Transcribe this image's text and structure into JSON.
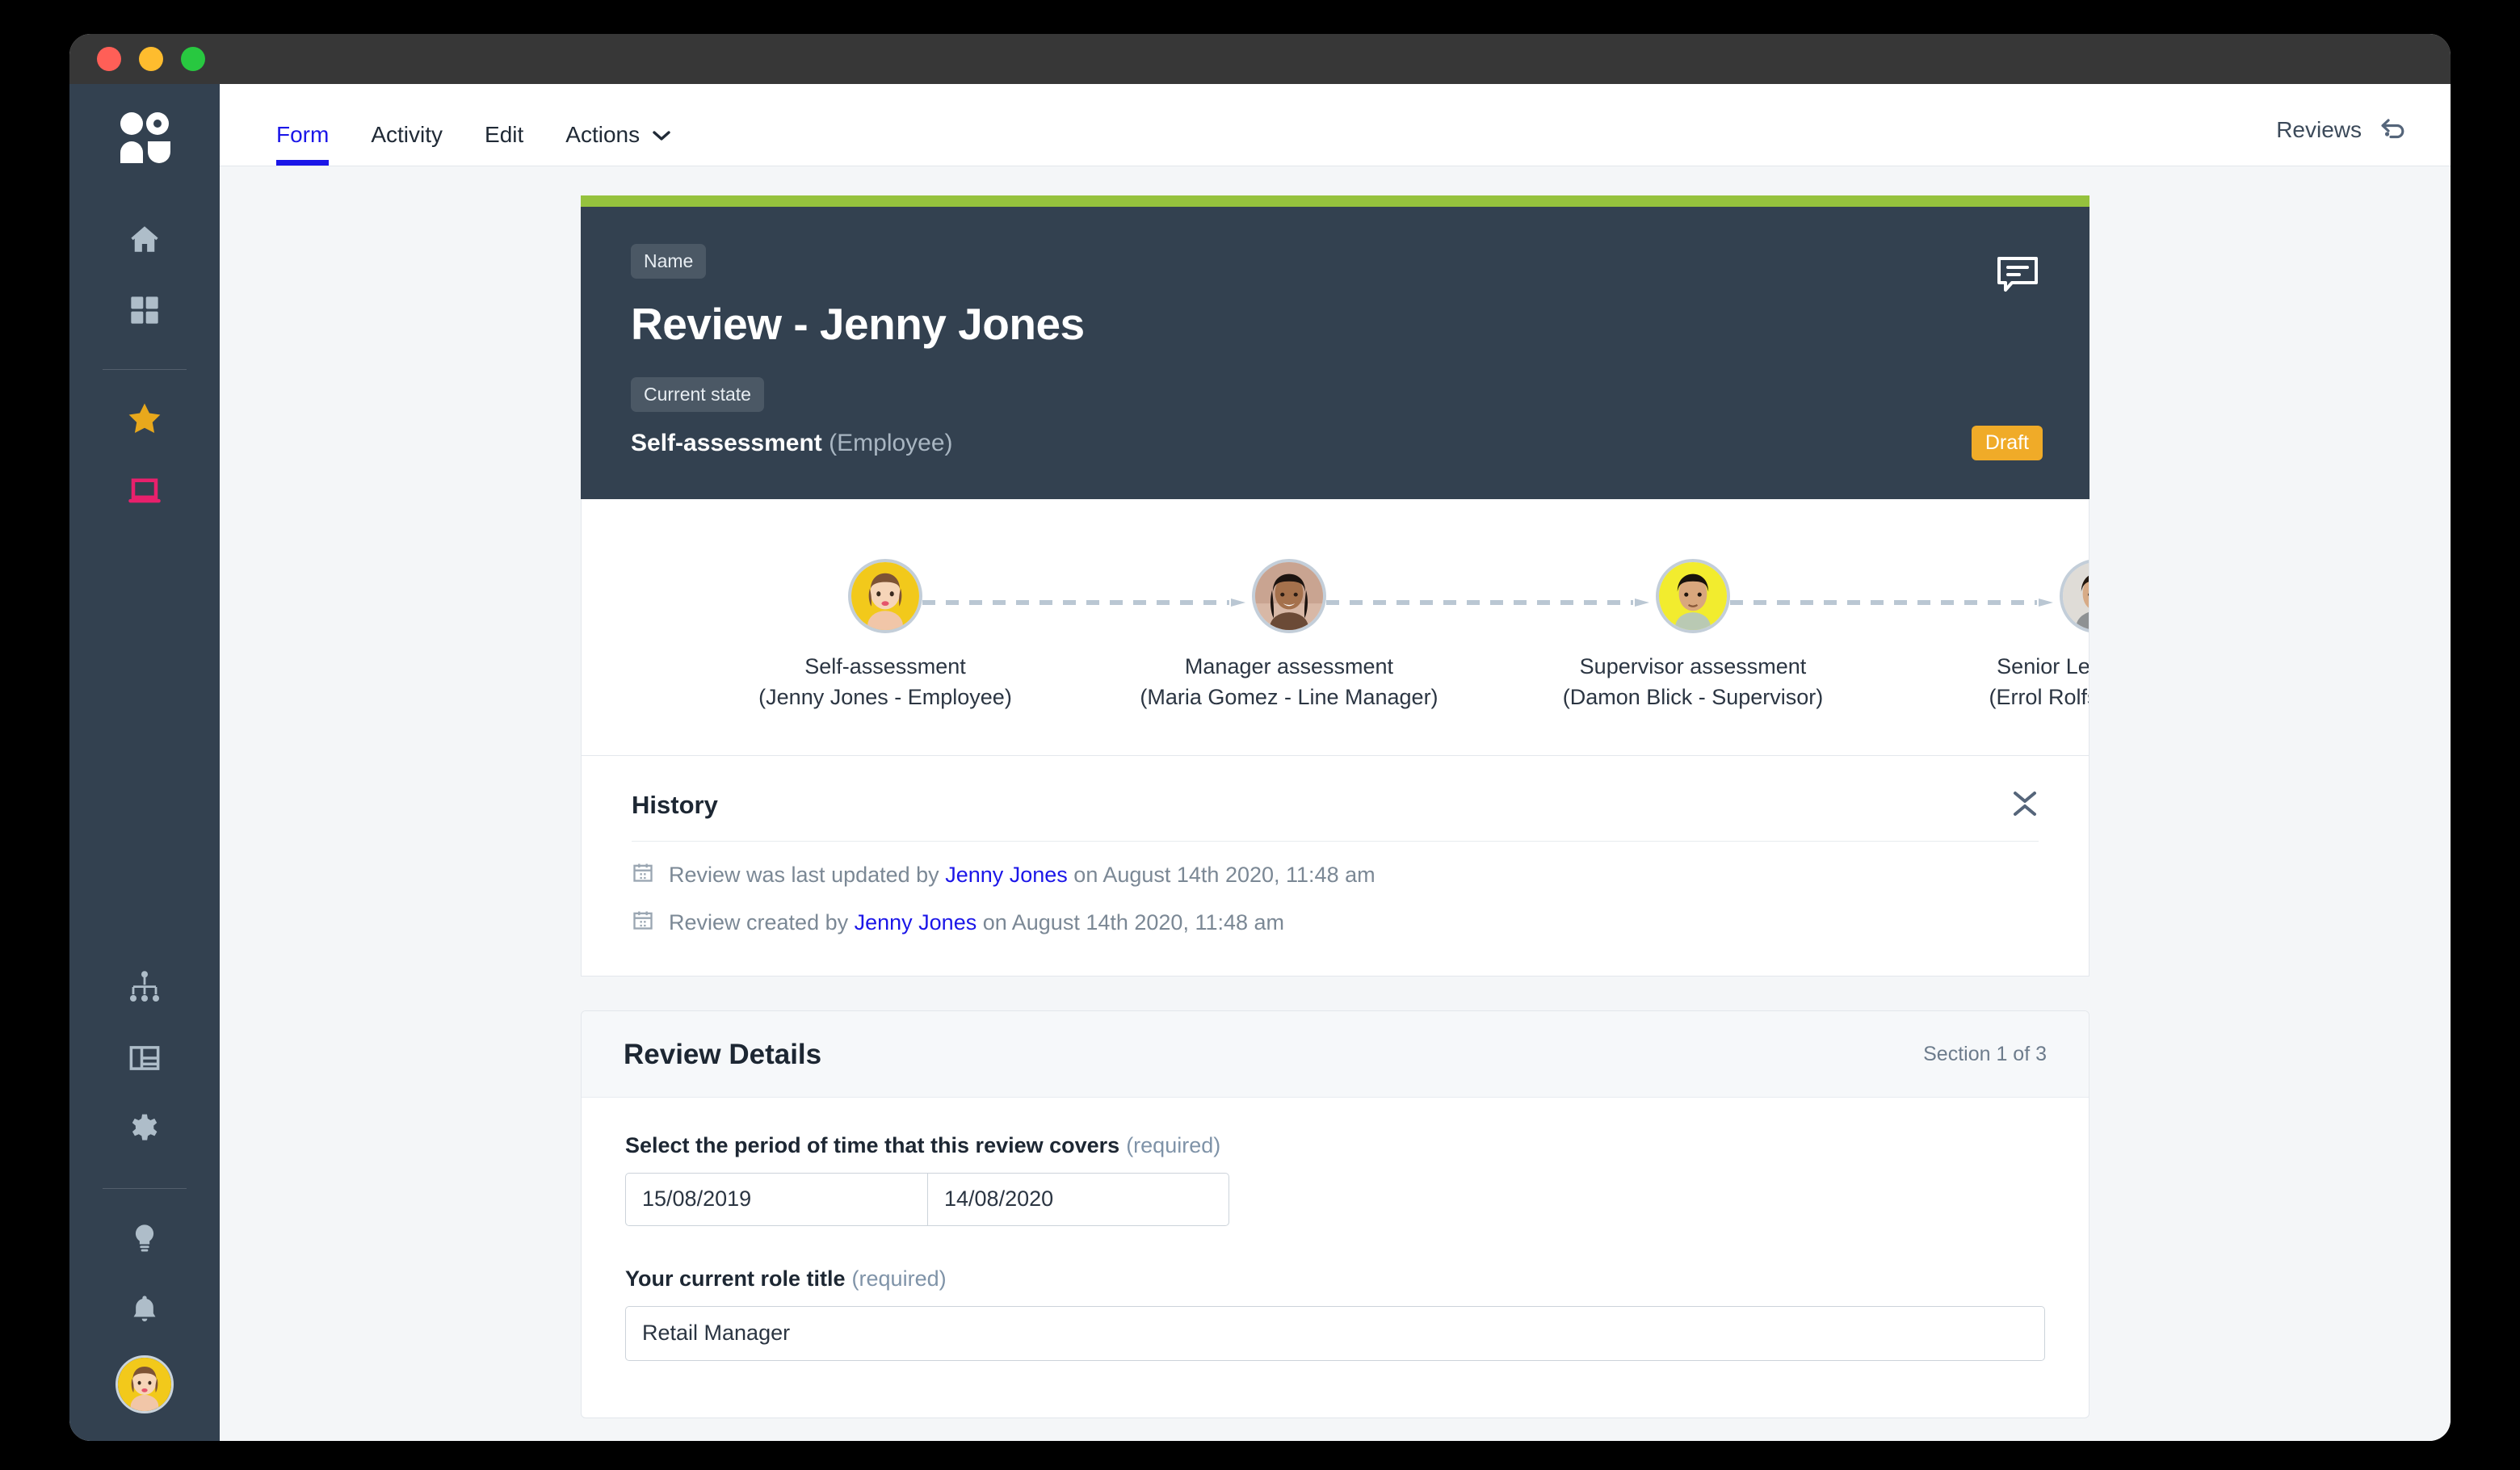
{
  "window": {
    "traffic_lights": [
      "close",
      "minimize",
      "maximize"
    ]
  },
  "sidebar": {
    "logo_name": "people-logo-icon",
    "items": [
      {
        "icon": "home-icon",
        "name": "sidebar-item-home"
      },
      {
        "icon": "grid-icon",
        "name": "sidebar-item-dashboard"
      },
      {
        "icon": "star-icon",
        "name": "sidebar-item-reviews"
      },
      {
        "icon": "laptop-icon",
        "name": "sidebar-item-learning"
      },
      {
        "icon": "org-chart-icon",
        "name": "sidebar-item-org-chart"
      },
      {
        "icon": "table-icon",
        "name": "sidebar-item-reports"
      },
      {
        "icon": "gear-icon",
        "name": "sidebar-item-settings"
      },
      {
        "icon": "lightbulb-icon",
        "name": "sidebar-item-ideas"
      },
      {
        "icon": "bell-icon",
        "name": "sidebar-item-notifications"
      }
    ],
    "avatar_name": "current-user-avatar"
  },
  "topbar": {
    "tabs": [
      {
        "label": "Form",
        "active": true
      },
      {
        "label": "Activity",
        "active": false
      },
      {
        "label": "Edit",
        "active": false
      },
      {
        "label": "Actions",
        "active": false,
        "has_dropdown": true
      }
    ],
    "back_label": "Reviews",
    "back_icon": "undo-arrow-icon"
  },
  "hero": {
    "accent_color": "#95c23d",
    "background_color": "#334150",
    "name_chip": "Name",
    "title": "Review - Jenny Jones",
    "state_chip": "Current state",
    "state": "Self-assessment",
    "state_role": "(Employee)",
    "status_badge": "Draft",
    "status_badge_color": "#f0ab28",
    "comment_icon": "comment-bubble-icon"
  },
  "stepper": {
    "steps": [
      {
        "title": "Self-assessment",
        "person": "(Jenny Jones - Employee)"
      },
      {
        "title": "Manager assessment",
        "person": "(Maria Gomez - Line Manager)"
      },
      {
        "title": "Supervisor assessment",
        "person": "(Damon Blick - Supervisor)"
      },
      {
        "title": "Senior Leader asses",
        "person": "(Errol Rolfson - Senior"
      }
    ]
  },
  "history": {
    "title": "History",
    "collapse_icon": "collapse-icon",
    "entries": [
      {
        "prefix": "Review was last updated by ",
        "link": "Jenny Jones",
        "suffix": " on August 14th 2020, 11:48 am"
      },
      {
        "prefix": "Review created by ",
        "link": "Jenny Jones",
        "suffix": " on August 14th 2020, 11:48 am"
      }
    ]
  },
  "section": {
    "title": "Review Details",
    "count": "Section 1 of 3",
    "fields": [
      {
        "label": "Select the period of time that this review covers",
        "required": "(required)",
        "type": "date-range",
        "start_value": "15/08/2019",
        "end_value": "14/08/2020"
      },
      {
        "label": "Your current role title",
        "required": "(required)",
        "type": "text",
        "value": "Retail Manager"
      }
    ]
  },
  "colors": {
    "accent_green": "#95c23d",
    "slate": "#334150",
    "link_blue": "#1b16e8",
    "draft_amber": "#f0ab28"
  }
}
